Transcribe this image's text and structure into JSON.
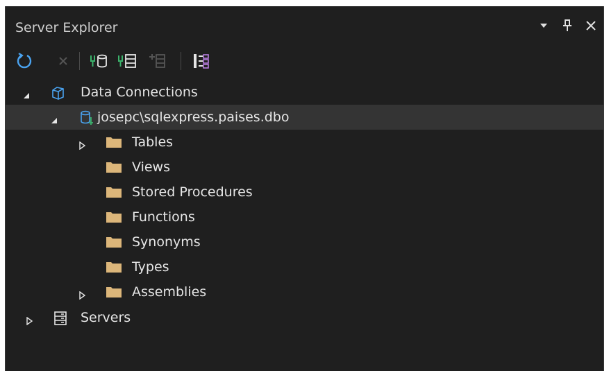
{
  "window": {
    "title": "Server Explorer"
  },
  "toolbar": {
    "buttons": [
      {
        "name": "refresh-icon"
      },
      {
        "name": "close-icon"
      },
      {
        "name": "connect-to-database-icon"
      },
      {
        "name": "connect-to-server-icon"
      },
      {
        "name": "add-item-icon"
      },
      {
        "name": "diagram-icon"
      }
    ]
  },
  "tree": {
    "data_connections": "Data Connections",
    "connection": "josepc\\sqlexpress.paises.dbo",
    "tables": "Tables",
    "views": "Views",
    "stored_procedures": "Stored Procedures",
    "functions": "Functions",
    "synonyms": "Synonyms",
    "types": "Types",
    "assemblies": "Assemblies",
    "servers": "Servers"
  },
  "colors": {
    "background": "#1f1f1f",
    "selected_row": "#343434",
    "folder": "#dcb67a",
    "accent_blue": "#4aa3f0",
    "accent_green": "#3bb36b"
  }
}
